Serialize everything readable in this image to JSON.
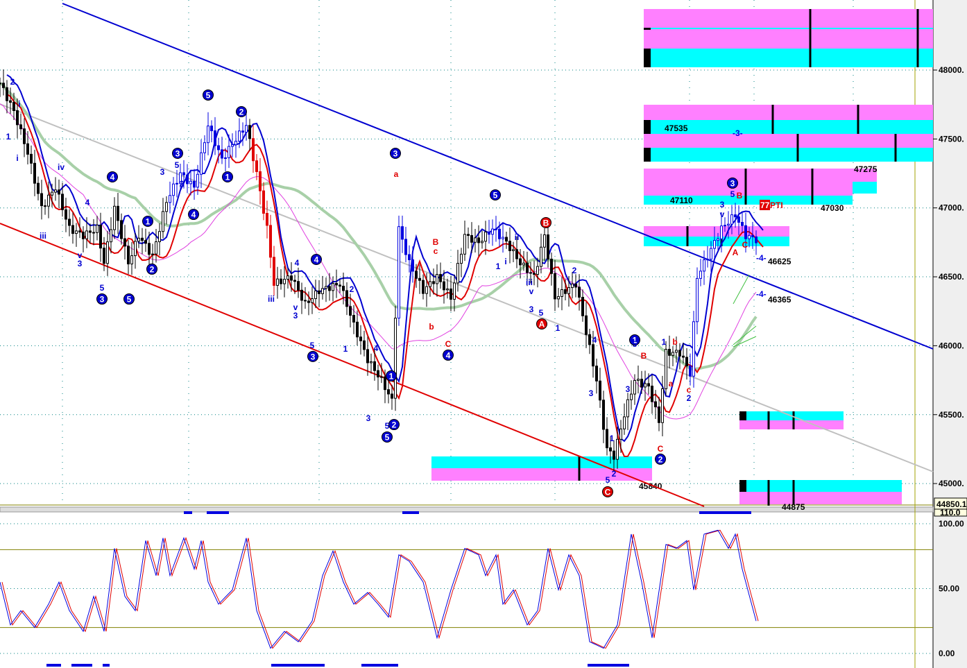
{
  "chart_data": {
    "type": "candlestick",
    "panels": [
      "price",
      "stochastic"
    ],
    "price_axis": {
      "ticks": [
        "48000.",
        "47500.",
        "47000.",
        "46500.",
        "46000.",
        "45500.",
        "45000."
      ],
      "tick_values": [
        48000,
        47500,
        47000,
        46500,
        46000,
        45500,
        45000
      ],
      "ylim": [
        44850,
        48500
      ],
      "last_price_label": "44850.1"
    },
    "osc_axis": {
      "ticks": [
        "100.00",
        "50.00",
        "0.00"
      ],
      "tick_values": [
        100,
        50,
        0
      ],
      "top_label": "110.0",
      "ylim": [
        0,
        110
      ],
      "levels": [
        80,
        20
      ]
    },
    "price_waypoints": [
      [
        0,
        47905
      ],
      [
        4,
        47700
      ],
      [
        8,
        47400
      ],
      [
        12,
        47000
      ],
      [
        16,
        47150
      ],
      [
        20,
        46850
      ],
      [
        24,
        46800
      ],
      [
        28,
        46850
      ],
      [
        30,
        46600
      ],
      [
        33,
        47000
      ],
      [
        37,
        46600
      ],
      [
        40,
        46800
      ],
      [
        44,
        46650
      ],
      [
        48,
        47050
      ],
      [
        52,
        47250
      ],
      [
        56,
        47150
      ],
      [
        60,
        47600
      ],
      [
        64,
        47350
      ],
      [
        68,
        47500
      ],
      [
        71,
        47600
      ],
      [
        74,
        47250
      ],
      [
        77,
        46850
      ],
      [
        79,
        46450
      ],
      [
        84,
        46500
      ],
      [
        88,
        46300
      ],
      [
        92,
        46400
      ],
      [
        98,
        46450
      ],
      [
        102,
        46150
      ],
      [
        106,
        45900
      ],
      [
        110,
        45750
      ],
      [
        113,
        45600
      ],
      [
        115,
        46850
      ],
      [
        118,
        46600
      ],
      [
        122,
        46400
      ],
      [
        126,
        46500
      ],
      [
        130,
        46350
      ],
      [
        134,
        46800
      ],
      [
        138,
        46750
      ],
      [
        142,
        46850
      ],
      [
        146,
        46750
      ],
      [
        150,
        46600
      ],
      [
        154,
        46500
      ],
      [
        157,
        46800
      ],
      [
        160,
        46350
      ],
      [
        166,
        46450
      ],
      [
        169,
        46100
      ],
      [
        172,
        45750
      ],
      [
        175,
        45250
      ],
      [
        177,
        45200
      ],
      [
        180,
        45500
      ],
      [
        183,
        45750
      ],
      [
        187,
        45700
      ],
      [
        190,
        45450
      ],
      [
        192,
        45950
      ],
      [
        196,
        45950
      ],
      [
        199,
        45800
      ],
      [
        201,
        46500
      ],
      [
        204,
        46650
      ],
      [
        208,
        46850
      ],
      [
        212,
        46950
      ],
      [
        215,
        46800
      ],
      [
        218,
        46770
      ]
    ],
    "stoch_waypoints": [
      [
        0,
        55
      ],
      [
        3,
        22
      ],
      [
        6,
        33
      ],
      [
        10,
        20
      ],
      [
        14,
        38
      ],
      [
        17,
        55
      ],
      [
        20,
        33
      ],
      [
        24,
        17
      ],
      [
        27,
        44
      ],
      [
        30,
        17
      ],
      [
        33,
        81
      ],
      [
        36,
        44
      ],
      [
        39,
        33
      ],
      [
        42,
        87
      ],
      [
        45,
        60
      ],
      [
        47,
        89
      ],
      [
        49,
        60
      ],
      [
        53,
        89
      ],
      [
        56,
        65
      ],
      [
        58,
        87
      ],
      [
        60,
        55
      ],
      [
        63,
        38
      ],
      [
        67,
        49
      ],
      [
        71,
        89
      ],
      [
        74,
        33
      ],
      [
        78,
        4
      ],
      [
        82,
        17
      ],
      [
        86,
        9
      ],
      [
        90,
        25
      ],
      [
        93,
        60
      ],
      [
        96,
        79
      ],
      [
        99,
        55
      ],
      [
        102,
        38
      ],
      [
        106,
        47
      ],
      [
        109,
        38
      ],
      [
        112,
        28
      ],
      [
        115,
        76
      ],
      [
        118,
        71
      ],
      [
        122,
        55
      ],
      [
        126,
        12
      ],
      [
        130,
        49
      ],
      [
        134,
        81
      ],
      [
        138,
        76
      ],
      [
        140,
        60
      ],
      [
        143,
        76
      ],
      [
        145,
        38
      ],
      [
        148,
        49
      ],
      [
        152,
        22
      ],
      [
        155,
        33
      ],
      [
        158,
        81
      ],
      [
        161,
        49
      ],
      [
        164,
        76
      ],
      [
        167,
        60
      ],
      [
        170,
        9
      ],
      [
        174,
        4
      ],
      [
        178,
        22
      ],
      [
        182,
        92
      ],
      [
        185,
        55
      ],
      [
        188,
        12
      ],
      [
        192,
        84
      ],
      [
        195,
        81
      ],
      [
        198,
        87
      ],
      [
        200,
        49
      ],
      [
        203,
        92
      ],
      [
        207,
        95
      ],
      [
        210,
        81
      ],
      [
        212,
        92
      ],
      [
        214,
        65
      ],
      [
        218,
        25
      ]
    ],
    "wave_labels_circled": [
      [
        "5",
        60,
        47819,
        "#0000d0"
      ],
      [
        "2",
        69.6,
        47698,
        "#0000d0"
      ],
      [
        "3",
        51.2,
        47396,
        "#0000d0"
      ],
      [
        "4",
        32.4,
        47225,
        "#0000d0"
      ],
      [
        "1",
        42.6,
        46903,
        "#0000d0"
      ],
      [
        "2",
        43.8,
        46556,
        "#0000d0"
      ],
      [
        "3",
        29.4,
        46339,
        "#0000d0"
      ],
      [
        "5",
        37.2,
        46339,
        "#0000d0"
      ],
      [
        "4",
        55.8,
        46953,
        "#0000d0"
      ],
      [
        "1",
        65.6,
        47225,
        "#0000d0"
      ],
      [
        "4",
        91.2,
        46626,
        "#0000d0"
      ],
      [
        "3",
        90.2,
        45922,
        "#0000d0"
      ],
      [
        "3",
        114,
        47396,
        "#0000d0"
      ],
      [
        "1",
        112.8,
        45781,
        "#0000d0"
      ],
      [
        "2",
        113.6,
        45428,
        "#0000d0"
      ],
      [
        "5",
        111.6,
        45338,
        "#0000d0"
      ],
      [
        "5",
        142.8,
        47094,
        "#0000d0"
      ],
      [
        "4",
        129.2,
        45932,
        "#0000d0"
      ],
      [
        "1",
        183,
        46042,
        "#0000d0"
      ],
      [
        "2",
        190.4,
        45177,
        "#0000d0"
      ],
      [
        "3",
        211.2,
        47180,
        "#0000d0"
      ],
      [
        "B",
        157.4,
        46893,
        "#e00000"
      ],
      [
        "A",
        156.2,
        46158,
        "#e00000"
      ],
      [
        "C",
        175.2,
        44940,
        "#e00000"
      ]
    ],
    "wave_labels": [
      [
        "1",
        2.4,
        47517,
        "#0000d0"
      ],
      [
        "2",
        3.6,
        47914,
        "#0000d0"
      ],
      [
        "i",
        5.6,
        47753,
        "#0000d0"
      ],
      [
        "i",
        5,
        47361,
        "#0000d0"
      ],
      [
        "iii",
        12.4,
        46797,
        "#0000d0"
      ],
      [
        "iv",
        17.6,
        47295,
        "#0000d0"
      ],
      [
        "v",
        23,
        46656,
        "#0000d0"
      ],
      [
        "3",
        23,
        46596,
        "#0000d0"
      ],
      [
        "4",
        25.2,
        47039,
        "#0000d0"
      ],
      [
        "5",
        29.4,
        46420,
        "#0000d0"
      ],
      [
        "3",
        46.8,
        47260,
        "#0000d0"
      ],
      [
        "5",
        51,
        47310,
        "#0000d0"
      ],
      [
        "2",
        52.4,
        47175,
        "#0000d0"
      ],
      [
        "4",
        85.6,
        46601,
        "#0000d0"
      ],
      [
        "v",
        85.2,
        46279,
        "#0000d0"
      ],
      [
        "3",
        85.2,
        46218,
        "#0000d0"
      ],
      [
        "iii",
        78.2,
        46339,
        "#0000d0"
      ],
      [
        "5",
        90,
        46002,
        "#0000d0"
      ],
      [
        "2",
        101.4,
        46410,
        "#0000d0"
      ],
      [
        "1",
        99.6,
        45977,
        "#0000d0"
      ],
      [
        "4",
        108.4,
        45982,
        "#0000d0"
      ],
      [
        "3",
        106.2,
        45473,
        "#0000d0"
      ],
      [
        "5",
        111.6,
        45418,
        "#0000d0"
      ],
      [
        "ii",
        149,
        46787,
        "#0000d0"
      ],
      [
        "i",
        145.8,
        46611,
        "#0000d0"
      ],
      [
        "1",
        143.6,
        46576,
        "#0000d0"
      ],
      [
        "iii",
        152.6,
        46460,
        "#0000d0"
      ],
      [
        "v",
        153.2,
        46394,
        "#0000d0"
      ],
      [
        "3",
        153.2,
        46264,
        "#0000d0"
      ],
      [
        "5",
        156,
        46238,
        "#0000d0"
      ],
      [
        "1",
        160.8,
        46128,
        "#0000d0"
      ],
      [
        "2",
        165.6,
        46545,
        "#0000d0"
      ],
      [
        "4",
        171.4,
        46042,
        "#0000d0"
      ],
      [
        "3",
        170.4,
        45655,
        "#0000d0"
      ],
      [
        "1",
        176.4,
        45327,
        "#0000d0"
      ],
      [
        "5",
        175.2,
        45026,
        "#0000d0"
      ],
      [
        "2",
        177,
        45071,
        "#0000d0"
      ],
      [
        "3",
        181,
        45685,
        "#0000d0"
      ],
      [
        "5",
        183,
        46012,
        "#0000d0"
      ],
      [
        "1",
        191.4,
        46027,
        "#0000d0"
      ],
      [
        "2",
        198.6,
        45619,
        "#0000d0"
      ],
      [
        "3",
        208.2,
        47024,
        "#0000d0"
      ],
      [
        "v",
        208.2,
        46953,
        "#0000d0"
      ],
      [
        "5",
        211.2,
        47099,
        "#0000d0"
      ],
      [
        "a",
        114.2,
        47245,
        "#e00000"
      ],
      [
        "B",
        125.6,
        46752,
        "#e00000"
      ],
      [
        "c",
        125.6,
        46686,
        "#e00000"
      ],
      [
        "b",
        124.4,
        46138,
        "#e00000"
      ],
      [
        "C",
        129.2,
        46012,
        "#e00000"
      ],
      [
        "B",
        185.6,
        45927,
        "#e00000"
      ],
      [
        "b",
        194.6,
        46027,
        "#e00000"
      ],
      [
        "a",
        193.4,
        45725,
        "#e00000"
      ],
      [
        "c",
        198.6,
        45680,
        "#e00000"
      ],
      [
        "C",
        190.4,
        45252,
        "#e00000"
      ],
      [
        "B",
        213.2,
        47089,
        "#e00000"
      ],
      [
        "A",
        212,
        46676,
        "#e00000"
      ],
      [
        "C",
        214.8,
        46732,
        "#e00000"
      ]
    ],
    "zone_labels": [
      "47535",
      "47110",
      "47275",
      "47030",
      "46625",
      "46365",
      "45840",
      "44875"
    ],
    "projection_labels": [
      "-3-",
      "-4-",
      "-4-"
    ],
    "pti_value": "77",
    "pti_label": "PTI"
  }
}
